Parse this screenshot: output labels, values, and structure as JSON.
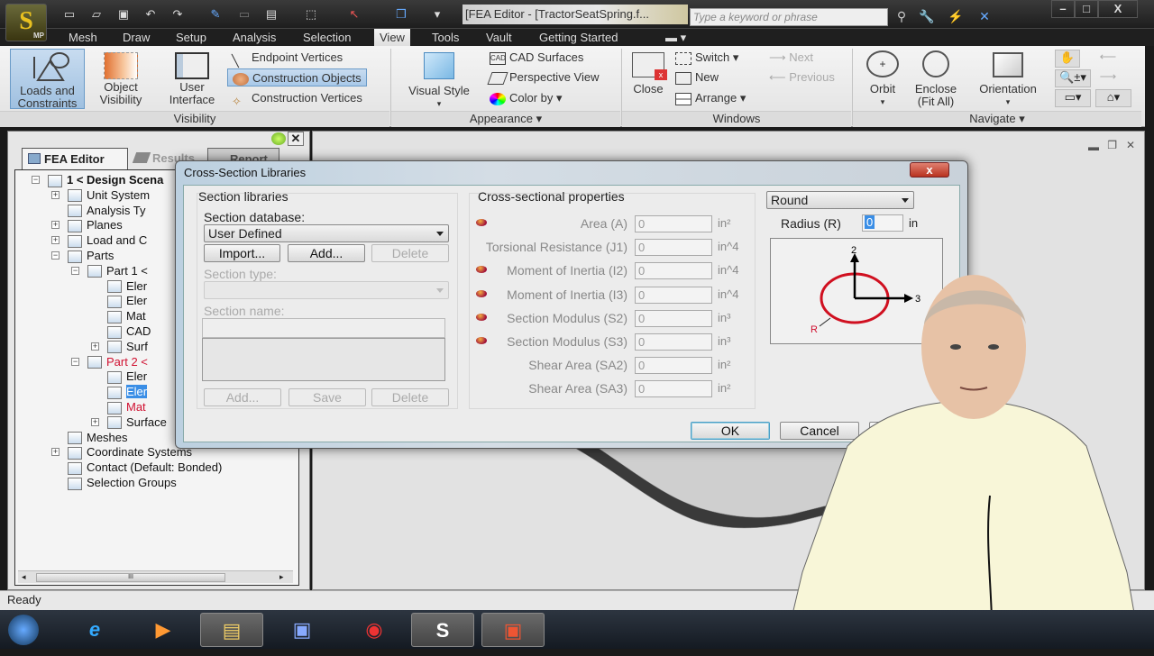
{
  "app": {
    "logo_letter": "S",
    "logo_badge": "MP",
    "window_title": "[FEA Editor - [TractorSeatSpring.f...",
    "search_placeholder": "Type a keyword or phrase",
    "window_controls": {
      "minimize": "–",
      "maximize": "□",
      "close": "X"
    }
  },
  "quick_access": [
    "new-icon",
    "open-icon",
    "save-icon",
    "undo-icon",
    "redo-icon",
    "edit-icon",
    "blank-icon",
    "table-icon",
    "select-box-icon",
    "pointer-icon",
    "view-cube-icon",
    "customize-icon"
  ],
  "menu_tabs": [
    {
      "label": "Mesh"
    },
    {
      "label": "Draw"
    },
    {
      "label": "Setup"
    },
    {
      "label": "Analysis"
    },
    {
      "label": "Selection"
    },
    {
      "label": "View",
      "active": true
    },
    {
      "label": "Tools"
    },
    {
      "label": "Vault"
    },
    {
      "label": "Getting Started"
    }
  ],
  "ribbon": {
    "visibility": {
      "label": "Visibility",
      "loads_constraints": "Loads and\nConstraints",
      "object_visibility": "Object\nVisibility",
      "user_interface": "User\nInterface",
      "endpoint_vertices": "Endpoint Vertices",
      "construction_objects": "Construction Objects",
      "construction_vertices": "Construction Vertices"
    },
    "appearance": {
      "label": "Appearance",
      "visual_style": "Visual Style",
      "cad_surfaces": "CAD Surfaces",
      "perspective_view": "Perspective View",
      "color_by": "Color by"
    },
    "windows": {
      "label": "Windows",
      "close": "Close",
      "switch": "Switch",
      "new": "New",
      "arrange": "Arrange",
      "next": "Next",
      "previous": "Previous"
    },
    "navigate": {
      "label": "Navigate",
      "orbit": "Orbit",
      "enclose": "Enclose\n(Fit All)",
      "orientation": "Orientation"
    }
  },
  "left_panel": {
    "tabs": [
      {
        "label": "FEA Editor",
        "active": true
      },
      {
        "label": "Results"
      },
      {
        "label": "Report"
      }
    ],
    "tree": [
      {
        "label": "1 < Design Scena",
        "level": 0,
        "bold": true,
        "expander": "−"
      },
      {
        "label": "Unit System",
        "level": 1,
        "expander": "+"
      },
      {
        "label": "Analysis Ty",
        "level": 1
      },
      {
        "label": "Planes",
        "level": 1,
        "expander": "+"
      },
      {
        "label": "Load and C",
        "level": 1,
        "expander": "+"
      },
      {
        "label": "Parts",
        "level": 1,
        "expander": "−"
      },
      {
        "label": "Part 1 <",
        "level": 2,
        "expander": "−"
      },
      {
        "label": "Eler",
        "level": 3
      },
      {
        "label": "Eler",
        "level": 3
      },
      {
        "label": "Mat",
        "level": 3
      },
      {
        "label": "CAD",
        "level": 3
      },
      {
        "label": "Surf",
        "level": 3,
        "expander": "+"
      },
      {
        "label": "Part 2 <",
        "level": 2,
        "expander": "−",
        "error": true
      },
      {
        "label": "Eler",
        "level": 3
      },
      {
        "label": "Eler",
        "level": 3,
        "selected": true
      },
      {
        "label": "Mat",
        "level": 3,
        "error": true
      },
      {
        "label": "Surface",
        "level": 3,
        "expander": "+"
      },
      {
        "label": "Meshes",
        "level": 1
      },
      {
        "label": "Coordinate Systems",
        "level": 1,
        "expander": "+"
      },
      {
        "label": "Contact (Default: Bonded)",
        "level": 1
      },
      {
        "label": "Selection Groups",
        "level": 1
      }
    ]
  },
  "status_bar": {
    "text": "Ready"
  },
  "dialog": {
    "title": "Cross-Section Libraries",
    "close_label": "x",
    "section_libraries": {
      "heading": "Section libraries",
      "database_label": "Section database:",
      "database_value": "User Defined",
      "import_button": "Import...",
      "add_button": "Add...",
      "delete_button": "Delete",
      "section_type_label": "Section type:",
      "section_type_value": "",
      "section_name_label": "Section name:",
      "section_name_value": "",
      "add2_button": "Add...",
      "save_button": "Save",
      "delete2_button": "Delete"
    },
    "properties": {
      "heading": "Cross-sectional properties",
      "rows": [
        {
          "label": "Area (A)",
          "value": "0",
          "unit": "in²",
          "marker": true
        },
        {
          "label": "Torsional Resistance (J1)",
          "value": "0",
          "unit": "in^4",
          "marker": false
        },
        {
          "label": "Moment of Inertia (I2)",
          "value": "0",
          "unit": "in^4",
          "marker": true
        },
        {
          "label": "Moment of Inertia (I3)",
          "value": "0",
          "unit": "in^4",
          "marker": true
        },
        {
          "label": "Section Modulus (S2)",
          "value": "0",
          "unit": "in³",
          "marker": true
        },
        {
          "label": "Section Modulus (S3)",
          "value": "0",
          "unit": "in³",
          "marker": true
        },
        {
          "label": "Shear Area (SA2)",
          "value": "0",
          "unit": "in²",
          "marker": false
        },
        {
          "label": "Shear Area (SA3)",
          "value": "0",
          "unit": "in²",
          "marker": false
        }
      ]
    },
    "shape": {
      "type_value": "Round",
      "radius_label": "Radius (R)",
      "radius_value": "0",
      "radius_unit": "in",
      "axis_2": "2",
      "axis_3": "3",
      "radius_marker": "R"
    },
    "ok_button": "OK",
    "cancel_button": "Cancel"
  },
  "taskbar": {
    "items": [
      {
        "name": "start-button",
        "glyph": "⊞"
      },
      {
        "name": "internet-explorer",
        "glyph": "e"
      },
      {
        "name": "media-player",
        "glyph": "▶"
      },
      {
        "name": "file-explorer",
        "glyph": "▤"
      },
      {
        "name": "network-computer",
        "glyph": "🖥"
      },
      {
        "name": "chrome",
        "glyph": "◉"
      },
      {
        "name": "simulation-app",
        "glyph": "S",
        "active": true
      },
      {
        "name": "powerpoint",
        "glyph": "▣",
        "active": true
      }
    ]
  },
  "colors": {
    "accent": "#3399ff",
    "error_red": "#d01030",
    "circle_red": "#d01020",
    "selection_blue": "#3a8ee6"
  }
}
